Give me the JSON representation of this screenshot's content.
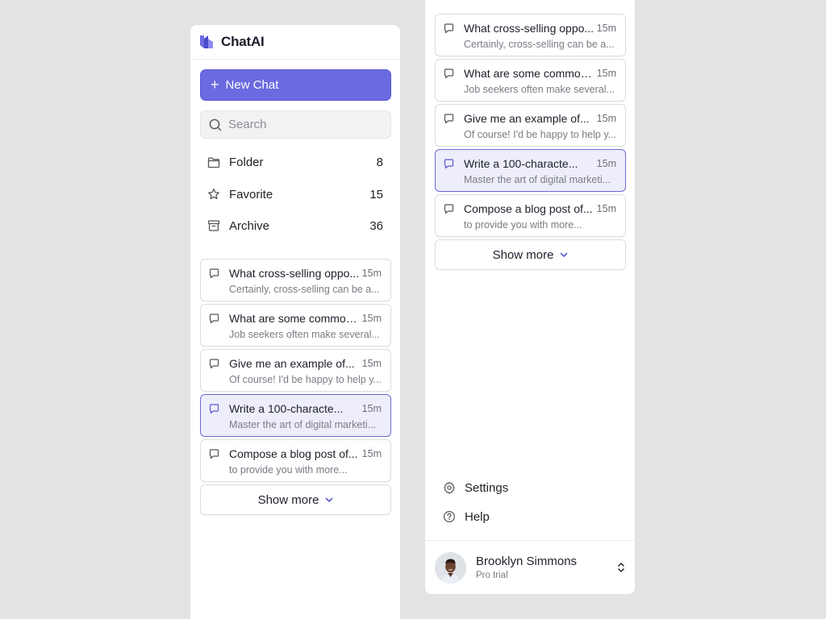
{
  "app": {
    "name": "ChatAI"
  },
  "sidebar": {
    "new_chat_label": "New Chat",
    "search_placeholder": "Search",
    "nav": [
      {
        "label": "Folder",
        "count": "8",
        "icon": "folder-icon"
      },
      {
        "label": "Favorite",
        "count": "15",
        "icon": "star-icon"
      },
      {
        "label": "Archive",
        "count": "36",
        "icon": "archive-icon"
      }
    ],
    "chats": [
      {
        "title": "What cross-selling oppo...",
        "time": "15m",
        "snippet": "Certainly, cross-selling can be a...",
        "active": false
      },
      {
        "title": "What are some common...",
        "time": "15m",
        "snippet": "Job seekers often make several...",
        "active": false
      },
      {
        "title": "Give me an example of...",
        "time": "15m",
        "snippet": "Of course! I'd be happy to help y...",
        "active": false
      },
      {
        "title": "Write a 100-characte...",
        "time": "15m",
        "snippet": "Master the art of digital marketi...",
        "active": true
      },
      {
        "title": "Compose a blog post of...",
        "time": "15m",
        "snippet": "to provide you with more...",
        "active": false
      }
    ],
    "show_more_label": "Show more",
    "footer": {
      "settings_label": "Settings",
      "help_label": "Help"
    },
    "user": {
      "name": "Brooklyn Simmons",
      "plan": "Pro trial"
    }
  },
  "colors": {
    "accent": "#6b6ae0",
    "active_bg": "#eeeefb",
    "active_border": "#6d6bd6",
    "background": "#e3e3e3"
  }
}
